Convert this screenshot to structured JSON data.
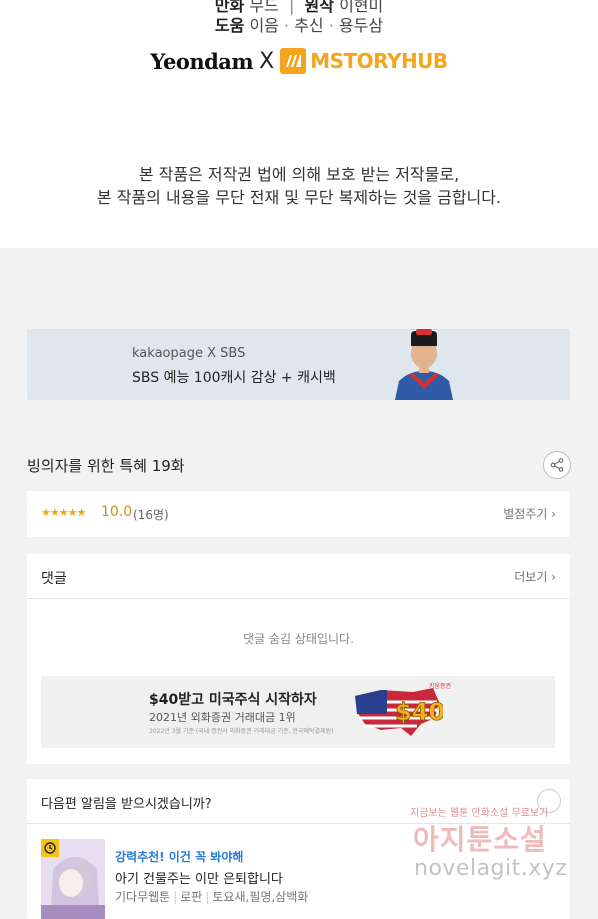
{
  "credits": {
    "line1": {
      "label1": "만화",
      "value1": "무드",
      "label2": "원작",
      "value2": "이현미"
    },
    "line2": {
      "label": "도움",
      "names": [
        "이음",
        "추신",
        "용두삼"
      ],
      "sep": "·"
    },
    "logos": {
      "yeondam": "Yeondam",
      "x": "X",
      "mstory": "MSTORYHUB"
    },
    "copyright": [
      "본 작품은 저작권 법에 의해 보호 받는 저작물로,",
      "본 작품의 내용을 무단 전재 및 무단 복제하는 것을 금합니다."
    ]
  },
  "banner": {
    "line1": "kakaopage X SBS",
    "line2": "SBS 예능 100캐시 감상 + 캐시백"
  },
  "episode": {
    "title": "빙의자를 위한 특혜 19화",
    "stars": "★★★★★",
    "score": "10.0",
    "count": "(16명)",
    "rate_link": "별점주기 ›"
  },
  "comments": {
    "heading": "댓글",
    "more": "더보기 ›",
    "hidden_message": "댓글 숨김 상태입니다."
  },
  "ad": {
    "title": "$40받고 미국주식 시작하자",
    "subtitle": "2021년 외화증권 거래대금 1위",
    "fine_print": "2022년 3월 기준 (국내 증권사 외화증권 거래대금 기준, 한국예탁결제원)",
    "badge_text": "$40",
    "brand": "키움증권"
  },
  "next": {
    "heading": "다음편 알림을 받으시겠습니까?",
    "rec_label": "강력추천! 이건 꼭 봐야해",
    "rec_title": "아기 건물주는 이만 은퇴합니다",
    "rec_meta": [
      "기다무웹툰",
      "로판",
      "토요새,필명,삼백화"
    ]
  },
  "watermark": {
    "small": "지금보는 웹툰 만화소설 무료보기",
    "big": "아지툰소설",
    "url": "novelagit.xyz"
  },
  "colors": {
    "star": "#f3a51d",
    "score": "#c9901a",
    "link_blue": "#2a7ad6",
    "mstory_orange": "#f3a51d",
    "banner_bg": "#dfe6ee"
  }
}
